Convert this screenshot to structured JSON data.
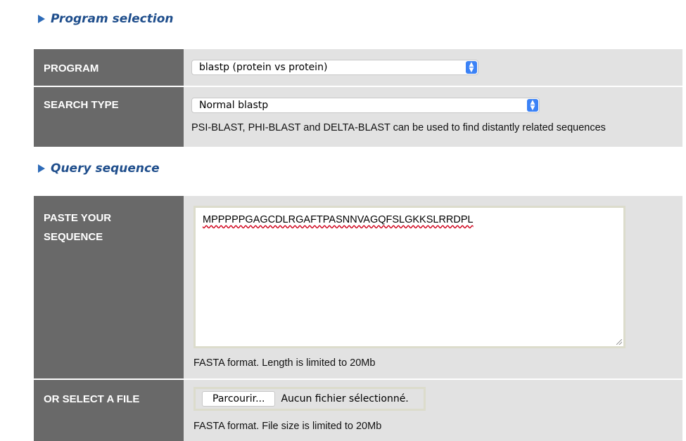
{
  "program_section": {
    "heading": "Program selection"
  },
  "program": {
    "label": "PROGRAM",
    "selected": "blastp (protein vs protein)"
  },
  "search_type": {
    "label": "SEARCH TYPE",
    "selected": "Normal blastp",
    "hint": "PSI-BLAST, PHI-BLAST and DELTA-BLAST can be used to find distantly related sequences"
  },
  "query_section": {
    "heading": "Query sequence"
  },
  "paste_sequence": {
    "label_line1": "PASTE YOUR",
    "label_line2": "SEQUENCE",
    "value": "MPPPPPGAGCDLRGAFTPASNNVAGQFSLGKKSLRRDPL",
    "hint": "FASTA format. Length is limited to 20Mb"
  },
  "select_file": {
    "label": "OR SELECT A FILE",
    "button_label": "Parcourir...",
    "status": "Aucun fichier sélectionné.",
    "hint": "FASTA format. File size is limited to 20Mb"
  }
}
